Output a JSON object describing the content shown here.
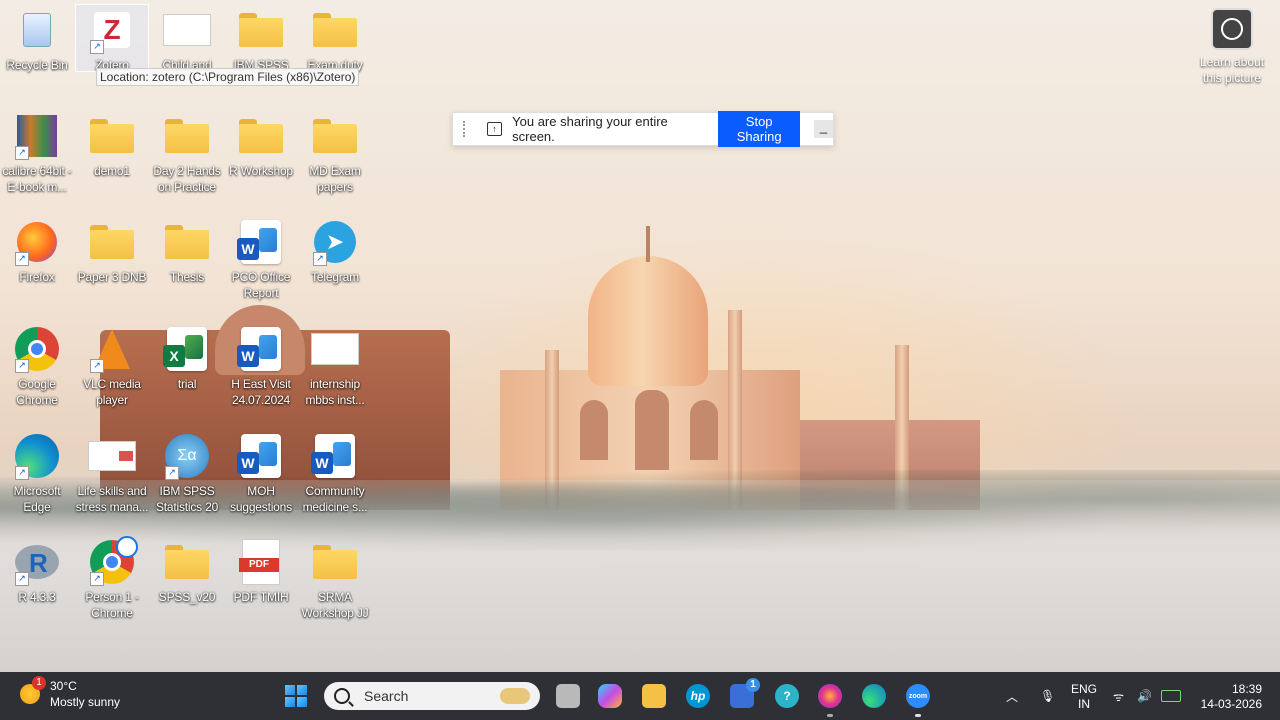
{
  "desktop": {
    "icons": [
      {
        "label": "Recycle Bin",
        "icon": "recycle-bin-icon"
      },
      {
        "label": "Zotero",
        "icon": "zotero-icon"
      },
      {
        "label": "Child and",
        "icon": "document-thumbnail-icon"
      },
      {
        "label": "IBM SPSS",
        "icon": "folder-icon"
      },
      {
        "label": "Exam duty",
        "icon": "folder-icon"
      },
      {
        "label": "calibre 64bit - E-book m...",
        "icon": "calibre-icon"
      },
      {
        "label": "demo1",
        "icon": "folder-icon"
      },
      {
        "label": "Day 2 Hands on Practice",
        "icon": "folder-icon"
      },
      {
        "label": "R Workshop",
        "icon": "folder-icon"
      },
      {
        "label": "MD Exam papers",
        "icon": "folder-icon"
      },
      {
        "label": "Firefox",
        "icon": "firefox-icon"
      },
      {
        "label": "Paper 3 DNB",
        "icon": "folder-icon"
      },
      {
        "label": "Thesis",
        "icon": "folder-icon"
      },
      {
        "label": "PCO Office Report",
        "icon": "word-document-icon"
      },
      {
        "label": "Telegram",
        "icon": "telegram-icon"
      },
      {
        "label": "Google Chrome",
        "icon": "chrome-icon"
      },
      {
        "label": "VLC media player",
        "icon": "vlc-icon"
      },
      {
        "label": "trial",
        "icon": "excel-document-icon"
      },
      {
        "label": "H East Visit 24.07.2024",
        "icon": "word-document-icon"
      },
      {
        "label": "internship mbbs inst...",
        "icon": "document-thumbnail-icon"
      },
      {
        "label": "Microsoft Edge",
        "icon": "edge-icon"
      },
      {
        "label": "Life skills and stress mana...",
        "icon": "presentation-thumbnail-icon"
      },
      {
        "label": "IBM SPSS Statistics 20",
        "icon": "spss-icon"
      },
      {
        "label": "MOH suggestions",
        "icon": "word-document-icon"
      },
      {
        "label": "Community medicine s...",
        "icon": "word-document-icon"
      },
      {
        "label": "R 4.3.3",
        "icon": "r-icon"
      },
      {
        "label": "Person 1 - Chrome",
        "icon": "chrome-profile-icon"
      },
      {
        "label": "SPSS_v20",
        "icon": "folder-icon"
      },
      {
        "label": "PDF TMIH",
        "icon": "pdf-icon"
      },
      {
        "label": "SRMA Workshop JJ",
        "icon": "folder-icon"
      }
    ],
    "tooltip": "Location: zotero (C:\\Program Files (x86)\\Zotero)",
    "learn_label": "Learn about this picture"
  },
  "share_bar": {
    "message": "You are sharing your entire screen.",
    "stop_label": "Stop Sharing",
    "minimize_glyph": "_"
  },
  "taskbar": {
    "weather_temp": "30°C",
    "weather_desc": "Mostly sunny",
    "weather_badge": "1",
    "search_placeholder": "Search",
    "store_badge": "1",
    "lang_line1": "ENG",
    "lang_line2": "IN",
    "time": "18:39",
    "date": "14-03-2026",
    "pdf_badge": "PDF",
    "zoom_label": "zoom"
  },
  "colors": {
    "taskbar_bg": "#2a2c30",
    "accent_blue": "#0b5cff",
    "folder_yellow": "#f4c045"
  }
}
